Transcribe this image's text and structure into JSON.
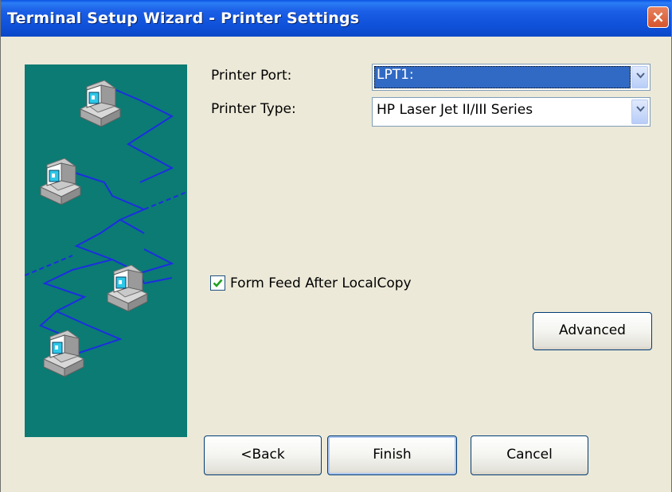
{
  "window": {
    "title": "Terminal Setup Wizard - Printer Settings",
    "close_glyph": "×"
  },
  "form": {
    "printer_port_label": "Printer Port:",
    "printer_port_value": "LPT1:",
    "printer_type_label": "Printer Type:",
    "printer_type_value": "HP Laser Jet II/III Series",
    "form_feed_label": "Form Feed After LocalCopy",
    "form_feed_checked": true
  },
  "buttons": {
    "advanced": "Advanced",
    "back": "<Back",
    "finish": "Finish",
    "cancel": "Cancel"
  },
  "colors": {
    "titlebar": "#0b52dc",
    "illustration_bg": "#0b7b74",
    "network_lines": "#1c2ee0",
    "selection": "#316ac5",
    "check": "#21a121"
  }
}
